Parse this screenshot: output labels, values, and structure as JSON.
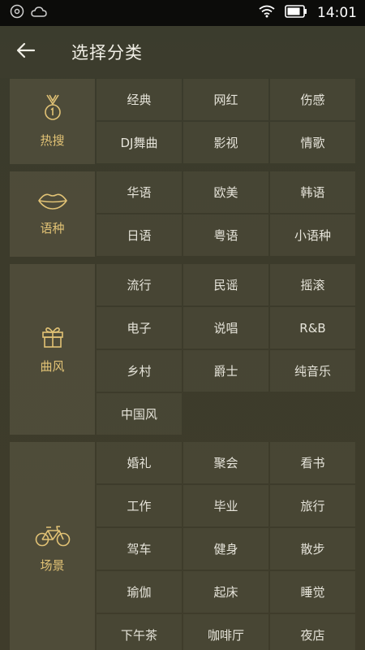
{
  "status": {
    "time": "14:01"
  },
  "header": {
    "title": "选择分类"
  },
  "sections": [
    {
      "label": "热搜",
      "icon": "medal-icon",
      "items": [
        "经典",
        "网红",
        "伤感",
        "DJ舞曲",
        "影视",
        "情歌"
      ]
    },
    {
      "label": "语种",
      "icon": "lips-icon",
      "items": [
        "华语",
        "欧美",
        "韩语",
        "日语",
        "粤语",
        "小语种"
      ]
    },
    {
      "label": "曲风",
      "icon": "gift-icon",
      "items": [
        "流行",
        "民谣",
        "摇滚",
        "电子",
        "说唱",
        "R&B",
        "乡村",
        "爵士",
        "纯音乐",
        "中国风"
      ]
    },
    {
      "label": "场景",
      "icon": "bicycle-icon",
      "items": [
        "婚礼",
        "聚会",
        "看书",
        "工作",
        "毕业",
        "旅行",
        "驾车",
        "健身",
        "散步",
        "瑜伽",
        "起床",
        "睡觉",
        "下午茶",
        "咖啡厅",
        "夜店"
      ]
    }
  ],
  "colors": {
    "accent": "#e1c275",
    "background": "#3c3b2b",
    "statusbar": "#0c0c0a"
  }
}
